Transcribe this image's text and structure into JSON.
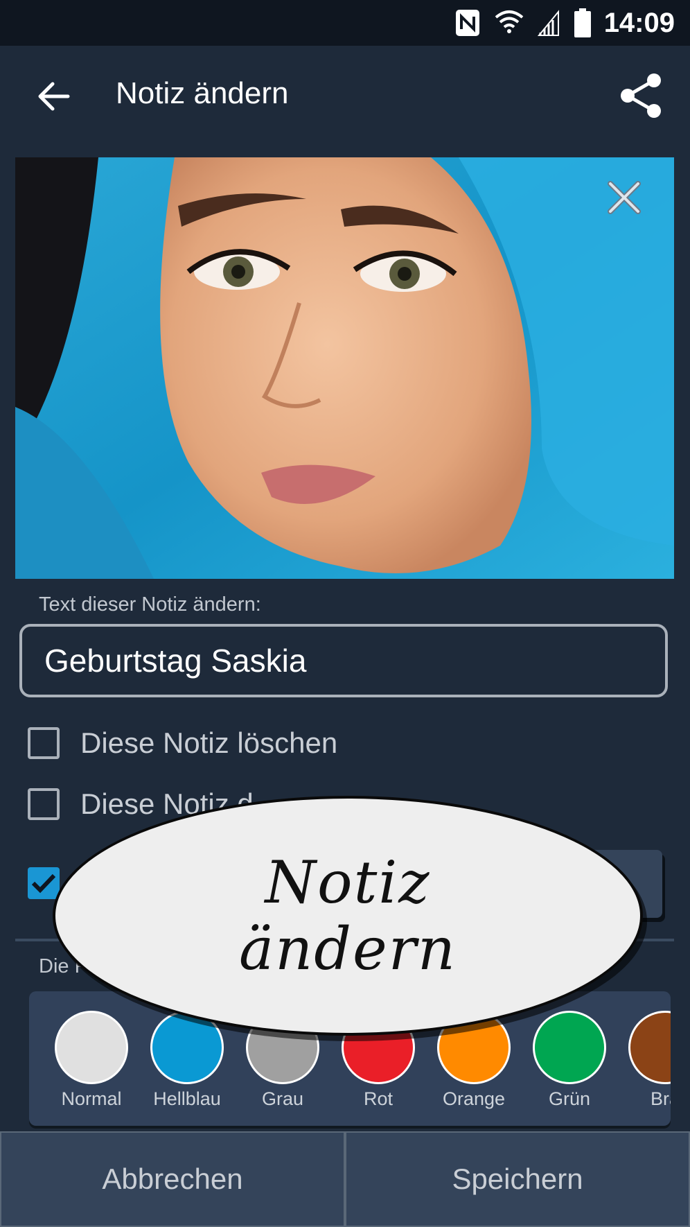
{
  "status_bar": {
    "time": "14:09",
    "icons": [
      "nfc-icon",
      "wifi-icon",
      "signal-icon",
      "battery-icon"
    ]
  },
  "app_bar": {
    "title": "Notiz ändern",
    "back_icon": "arrow-left-icon",
    "share_icon": "share-icon"
  },
  "photo": {
    "description_icon": "photo-image",
    "close_icon": "close-x-icon"
  },
  "form": {
    "text_label": "Text dieser Notiz ändern:",
    "text_value": "Geburtstag Saskia",
    "checkboxes": [
      {
        "label": "Diese Notiz löschen",
        "checked": false
      },
      {
        "label": "Diese Notiz d",
        "checked": false
      },
      {
        "label": "",
        "checked": true
      }
    ],
    "color_label": "Die F"
  },
  "colors": [
    {
      "name": "Normal",
      "hex": "#e0e0e0"
    },
    {
      "name": "Hellblau",
      "hex": "#0a99d3"
    },
    {
      "name": "Grau",
      "hex": "#a0a0a0"
    },
    {
      "name": "Rot",
      "hex": "#ea1f28"
    },
    {
      "name": "Orange",
      "hex": "#ff8a00"
    },
    {
      "name": "Grün",
      "hex": "#00a651"
    },
    {
      "name": "Bra",
      "hex": "#8b4316"
    }
  ],
  "buttons": {
    "cancel": "Abbrechen",
    "save": "Speichern"
  },
  "callout": {
    "line1": "Notiz",
    "line2": "ändern"
  },
  "theme": {
    "background": "#1e2a3a",
    "accent": "#1a96d4",
    "button_bg": "#34445a"
  }
}
